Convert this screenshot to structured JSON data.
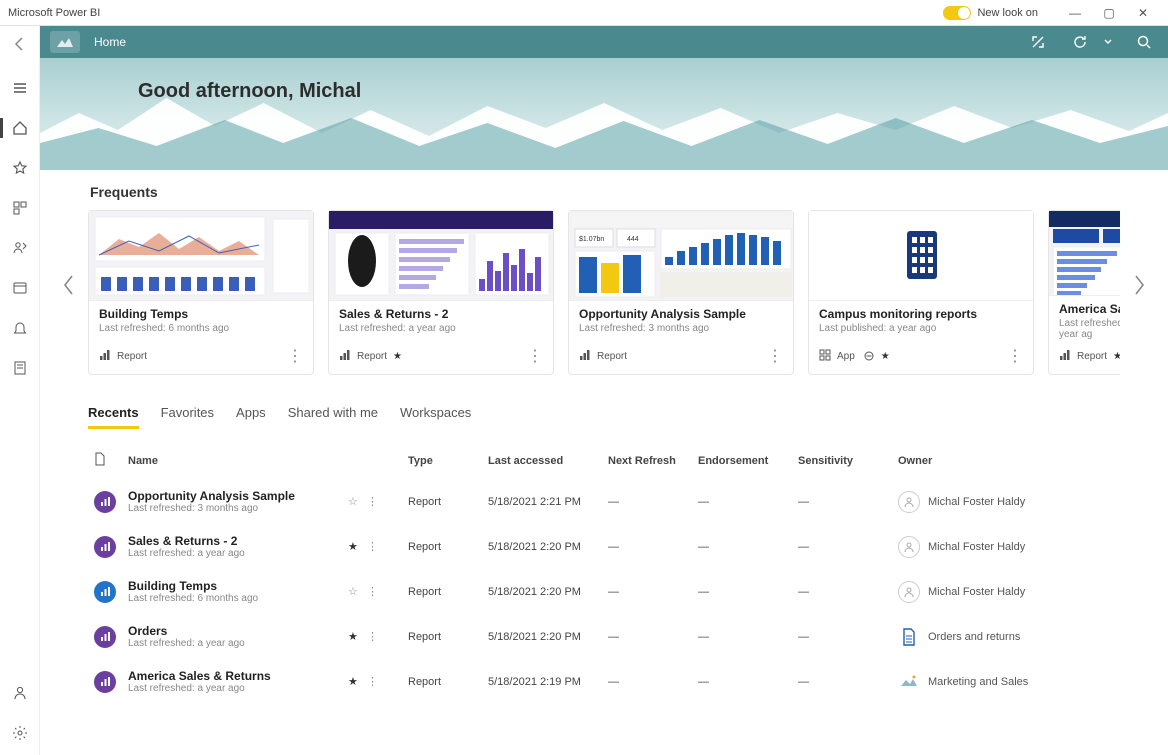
{
  "window": {
    "title": "Microsoft Power BI",
    "toggle_label": "New look on"
  },
  "header": {
    "breadcrumb": "Home"
  },
  "hero": {
    "greeting": "Good afternoon, Michal"
  },
  "nav_semantic": [
    "menu",
    "home",
    "favorites",
    "apps",
    "recent",
    "workspaces",
    "notifications",
    "deployment"
  ],
  "frequents": {
    "title": "Frequents",
    "cards": [
      {
        "title": "Building Temps",
        "subtitle": "Last refreshed: 6 months ago",
        "type_label": "Report",
        "starred": false,
        "icon_color": "purple"
      },
      {
        "title": "Sales & Returns  - 2",
        "subtitle": "Last refreshed: a year ago",
        "type_label": "Report",
        "starred": true,
        "icon_color": "purple"
      },
      {
        "title": "Opportunity Analysis Sample",
        "subtitle": "Last refreshed: 3 months ago",
        "type_label": "Report",
        "starred": false,
        "icon_color": "purple"
      },
      {
        "title": "Campus monitoring reports",
        "subtitle": "Last published: a year ago",
        "type_label": "App",
        "starred": true,
        "icon_color": "blue"
      },
      {
        "title": "America Sales &",
        "subtitle": "Last refreshed: a year ag",
        "type_label": "Report",
        "starred": true,
        "icon_color": "purple"
      }
    ]
  },
  "tabs": {
    "items": [
      "Recents",
      "Favorites",
      "Apps",
      "Shared with me",
      "Workspaces"
    ],
    "selected": 0
  },
  "table": {
    "columns": [
      "",
      "Name",
      "",
      "Type",
      "Last accessed",
      "Next Refresh",
      "Endorsement",
      "Sensitivity",
      "Owner"
    ],
    "rows": [
      {
        "icon": "purple",
        "name": "Opportunity Analysis Sample",
        "sub": "Last refreshed: 3 months ago",
        "starred": false,
        "type": "Report",
        "lastAccessed": "5/18/2021 2:21 PM",
        "nextRefresh": "—",
        "endorsement": "—",
        "sensitivity": "—",
        "owner": "Michal Foster Haldy",
        "ownerKind": "person"
      },
      {
        "icon": "purple",
        "name": "Sales & Returns  - 2",
        "sub": "Last refreshed: a year ago",
        "starred": true,
        "type": "Report",
        "lastAccessed": "5/18/2021 2:20 PM",
        "nextRefresh": "—",
        "endorsement": "—",
        "sensitivity": "—",
        "owner": "Michal Foster Haldy",
        "ownerKind": "person"
      },
      {
        "icon": "blue",
        "name": "Building Temps",
        "sub": "Last refreshed: 6 months ago",
        "starred": false,
        "type": "Report",
        "lastAccessed": "5/18/2021 2:20 PM",
        "nextRefresh": "—",
        "endorsement": "—",
        "sensitivity": "—",
        "owner": "Michal Foster Haldy",
        "ownerKind": "person"
      },
      {
        "icon": "purple",
        "name": "Orders",
        "sub": "Last refreshed: a year ago",
        "starred": true,
        "type": "Report",
        "lastAccessed": "5/18/2021 2:20 PM",
        "nextRefresh": "—",
        "endorsement": "—",
        "sensitivity": "—",
        "owner": "Orders and returns",
        "ownerKind": "workspace"
      },
      {
        "icon": "purple",
        "name": "America Sales & Returns",
        "sub": "Last refreshed: a year ago",
        "starred": true,
        "type": "Report",
        "lastAccessed": "5/18/2021 2:19 PM",
        "nextRefresh": "—",
        "endorsement": "—",
        "sensitivity": "—",
        "owner": "Marketing and Sales",
        "ownerKind": "workspace"
      }
    ]
  }
}
